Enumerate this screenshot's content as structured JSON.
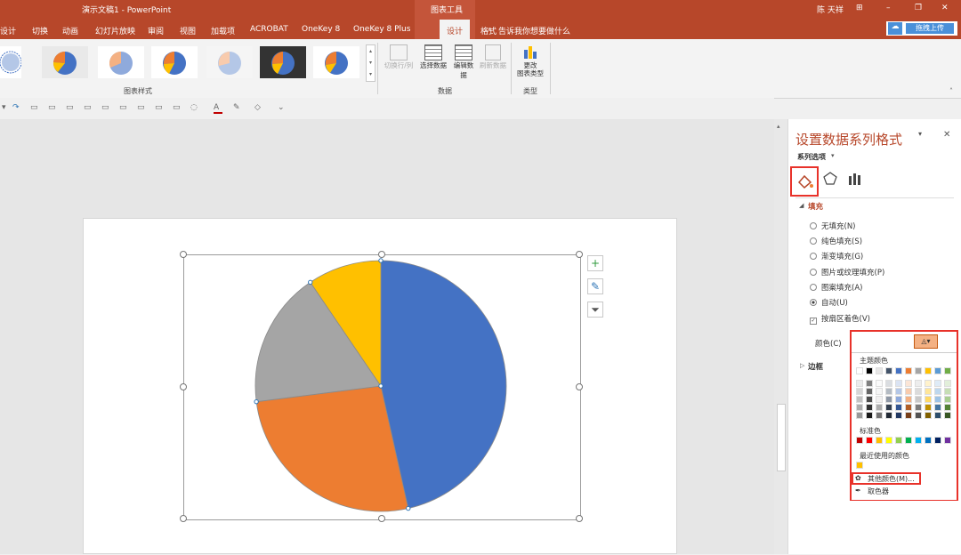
{
  "window": {
    "title": "演示文稿1 - PowerPoint",
    "context_tools": "图表工具",
    "user": "陈 天祥",
    "upload_label": "拖拽上传"
  },
  "tabs": [
    "设计",
    "切换",
    "动画",
    "幻灯片放映",
    "审阅",
    "视图",
    "加载项",
    "ACROBAT",
    "OneKey 8",
    "OneKey 8 Plus",
    "设计",
    "格式"
  ],
  "search_placeholder": "告诉我你想要做什么",
  "ribbon": {
    "group_styles": "图表样式",
    "group_data": "数据",
    "group_type": "类型",
    "btn_switch": "切换行/列",
    "btn_select": "选择数据",
    "btn_edit": "编辑数据",
    "btn_refresh": "刷新数据",
    "btn_change_type": "更改\n图表类型"
  },
  "pane": {
    "title": "设置数据系列格式",
    "options_label": "系列选项",
    "fill_section": "填充",
    "fill_options": [
      "无填充(N)",
      "纯色填充(S)",
      "渐变填充(G)",
      "图片或纹理填充(P)",
      "图案填充(A)",
      "自动(U)"
    ],
    "selected_fill": "自动(U)",
    "vary_by_point": "按扇区着色(V)",
    "color_label": "颜色(C)",
    "border_section": "边框"
  },
  "picker": {
    "theme_colors": "主题颜色",
    "standard_colors": "标准色",
    "recent_colors": "最近使用的颜色",
    "more_colors": "其他颜色(M)...",
    "eyedropper": "取色器",
    "theme_row": [
      "#ffffff",
      "#000000",
      "#e7e6e6",
      "#44546a",
      "#4472c4",
      "#ed7d31",
      "#a5a5a5",
      "#ffc000",
      "#5b9bd5",
      "#70ad47"
    ],
    "standard_row": [
      "#c00000",
      "#ff0000",
      "#ffc000",
      "#ffff00",
      "#92d050",
      "#00b050",
      "#00b0f0",
      "#0070c0",
      "#002060",
      "#7030a0"
    ],
    "recent_row": [
      "#ffc000"
    ]
  },
  "chart_data": {
    "type": "pie",
    "values": [
      46.5,
      26.5,
      17.5,
      9.5
    ],
    "colors": [
      "#4472c4",
      "#ed7d31",
      "#a5a5a5",
      "#ffc000"
    ]
  }
}
